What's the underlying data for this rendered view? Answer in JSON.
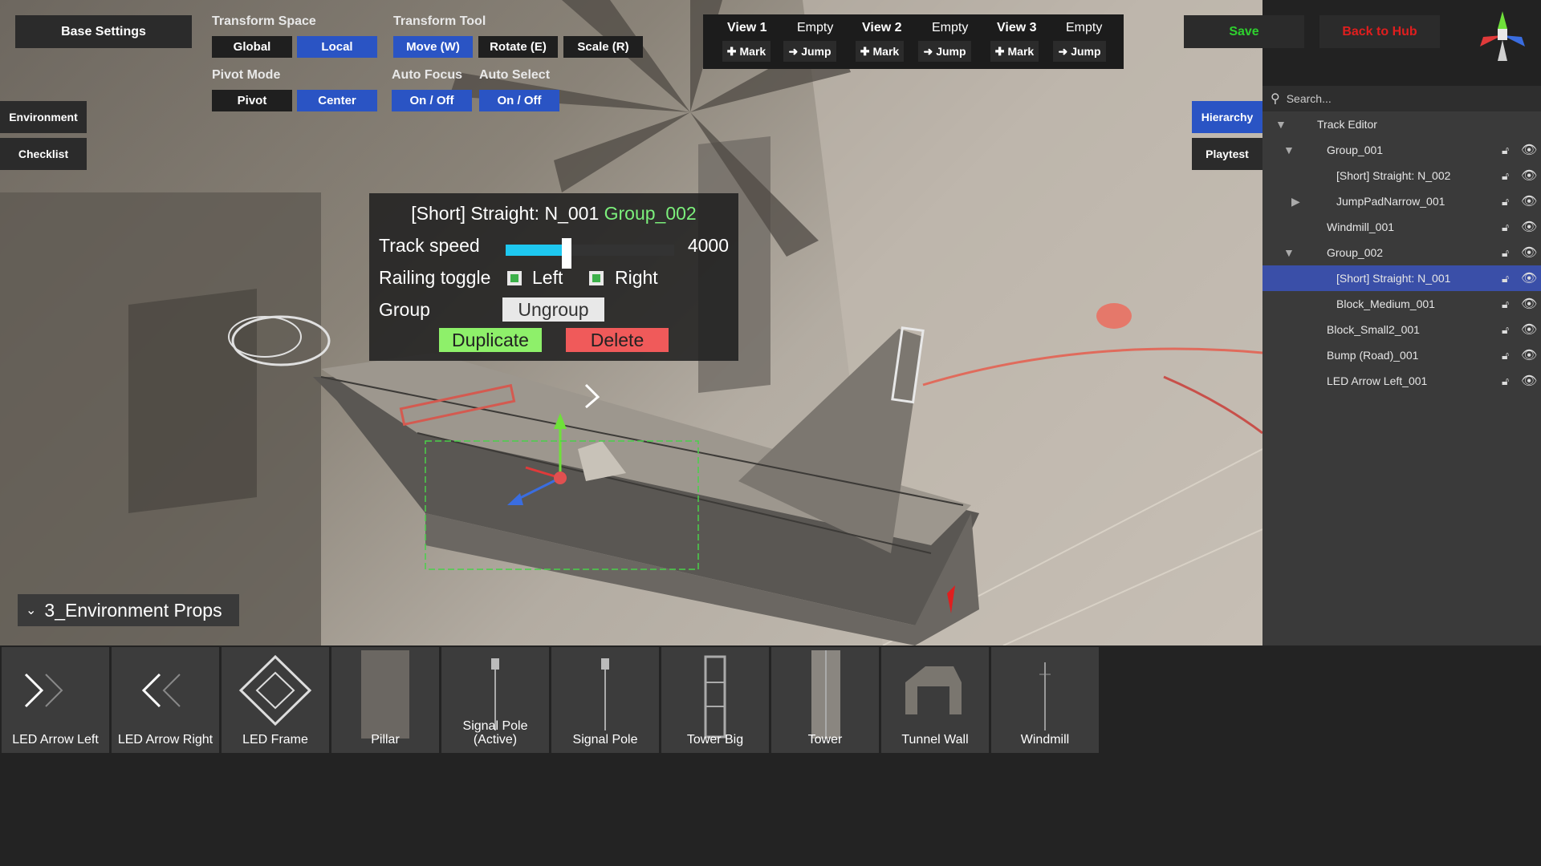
{
  "toolbar": {
    "base_settings": "Base Settings",
    "transform_space": {
      "label": "Transform Space",
      "global": "Global",
      "local": "Local"
    },
    "transform_tool": {
      "label": "Transform Tool",
      "move": "Move (W)",
      "rotate": "Rotate (E)",
      "scale": "Scale (R)"
    },
    "pivot_mode": {
      "label": "Pivot Mode",
      "pivot": "Pivot",
      "center": "Center"
    },
    "auto_focus": {
      "label": "Auto Focus",
      "toggle": "On / Off"
    },
    "auto_select": {
      "label": "Auto Select",
      "toggle": "On / Off"
    },
    "save": "Save",
    "back_to_hub": "Back to  Hub"
  },
  "views": [
    {
      "name": "View 1",
      "state": "Empty",
      "mark": "Mark",
      "jump": "Jump"
    },
    {
      "name": "View 2",
      "state": "Empty",
      "mark": "Mark",
      "jump": "Jump"
    },
    {
      "name": "View 3",
      "state": "Empty",
      "mark": "Mark",
      "jump": "Jump"
    }
  ],
  "left_tabs": {
    "environment": "Environment",
    "checklist": "Checklist"
  },
  "right_tabs": {
    "hierarchy": "Hierarchy",
    "playtest": "Playtest"
  },
  "inspector": {
    "title": "[Short] Straight: N_001",
    "group_name": "Group_002",
    "track_speed_label": "Track speed",
    "track_speed_value": "4000",
    "track_speed_fraction": 0.36,
    "railing_label": "Railing toggle",
    "left": "Left",
    "right": "Right",
    "group_label": "Group",
    "ungroup": "Ungroup",
    "duplicate": "Duplicate",
    "delete": "Delete"
  },
  "hierarchy": {
    "search_placeholder": "Search...",
    "root": "Track Editor",
    "items": [
      {
        "label": "Group_001"
      },
      {
        "label": "[Short] Straight: N_002"
      },
      {
        "label": "JumpPadNarrow_001"
      },
      {
        "label": "Windmill_001"
      },
      {
        "label": "Group_002"
      },
      {
        "label": "[Short] Straight: N_001"
      },
      {
        "label": "Block_Medium_001"
      },
      {
        "label": "Block_Small2_001"
      },
      {
        "label": "Bump (Road)_001"
      },
      {
        "label": "LED Arrow Left_001"
      }
    ]
  },
  "category": "3_Environment Props",
  "props": [
    {
      "label": "LED Arrow Left",
      "icon": "led-arrow-left-icon"
    },
    {
      "label": "LED Arrow Right",
      "icon": "led-arrow-right-icon"
    },
    {
      "label": "LED Frame",
      "icon": "led-frame-icon"
    },
    {
      "label": "Pillar",
      "icon": "pillar-icon"
    },
    {
      "label": "Signal Pole (Active)",
      "icon": "signal-pole-icon"
    },
    {
      "label": "Signal Pole",
      "icon": "signal-pole-icon"
    },
    {
      "label": "Tower Big",
      "icon": "tower-big-icon"
    },
    {
      "label": "Tower",
      "icon": "tower-icon"
    },
    {
      "label": "Tunnel Wall",
      "icon": "tunnel-wall-icon"
    },
    {
      "label": "Windmill",
      "icon": "windmill-icon"
    }
  ],
  "colors": {
    "accent_blue": "#2a54c4",
    "save_green": "#2ed12e",
    "back_red": "#e01e1e",
    "group_green": "#7cf07c",
    "duplicate_bg": "#8ef06a",
    "delete_bg": "#f05a5a",
    "selection": "#3a4fa8"
  }
}
